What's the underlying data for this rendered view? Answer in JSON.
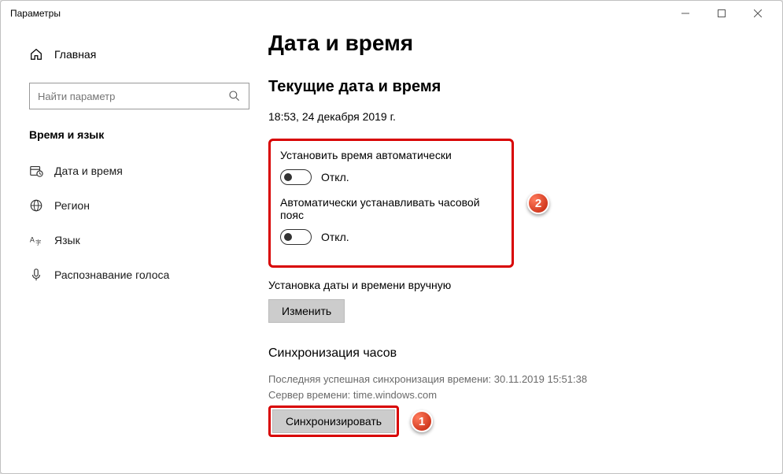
{
  "window": {
    "title": "Параметры"
  },
  "sidebar": {
    "home": "Главная",
    "search_placeholder": "Найти параметр",
    "category": "Время и язык",
    "items": [
      {
        "label": "Дата и время"
      },
      {
        "label": "Регион"
      },
      {
        "label": "Язык"
      },
      {
        "label": "Распознавание голоса"
      }
    ]
  },
  "page": {
    "title": "Дата и время",
    "current_section": "Текущие дата и время",
    "current_value": "18:53, 24 декабря 2019 г.",
    "auto_time": {
      "label": "Установить время автоматически",
      "state": "Откл."
    },
    "auto_tz": {
      "label": "Автоматически устанавливать часовой пояс",
      "state": "Откл."
    },
    "manual_label": "Установка даты и времени вручную",
    "change_button": "Изменить",
    "sync": {
      "title": "Синхронизация часов",
      "last_line": "Последняя успешная синхронизация времени: 30.11.2019 15:51:38",
      "server_line": "Сервер времени: time.windows.com",
      "button": "Синхронизировать"
    }
  },
  "callouts": {
    "one": "1",
    "two": "2"
  }
}
